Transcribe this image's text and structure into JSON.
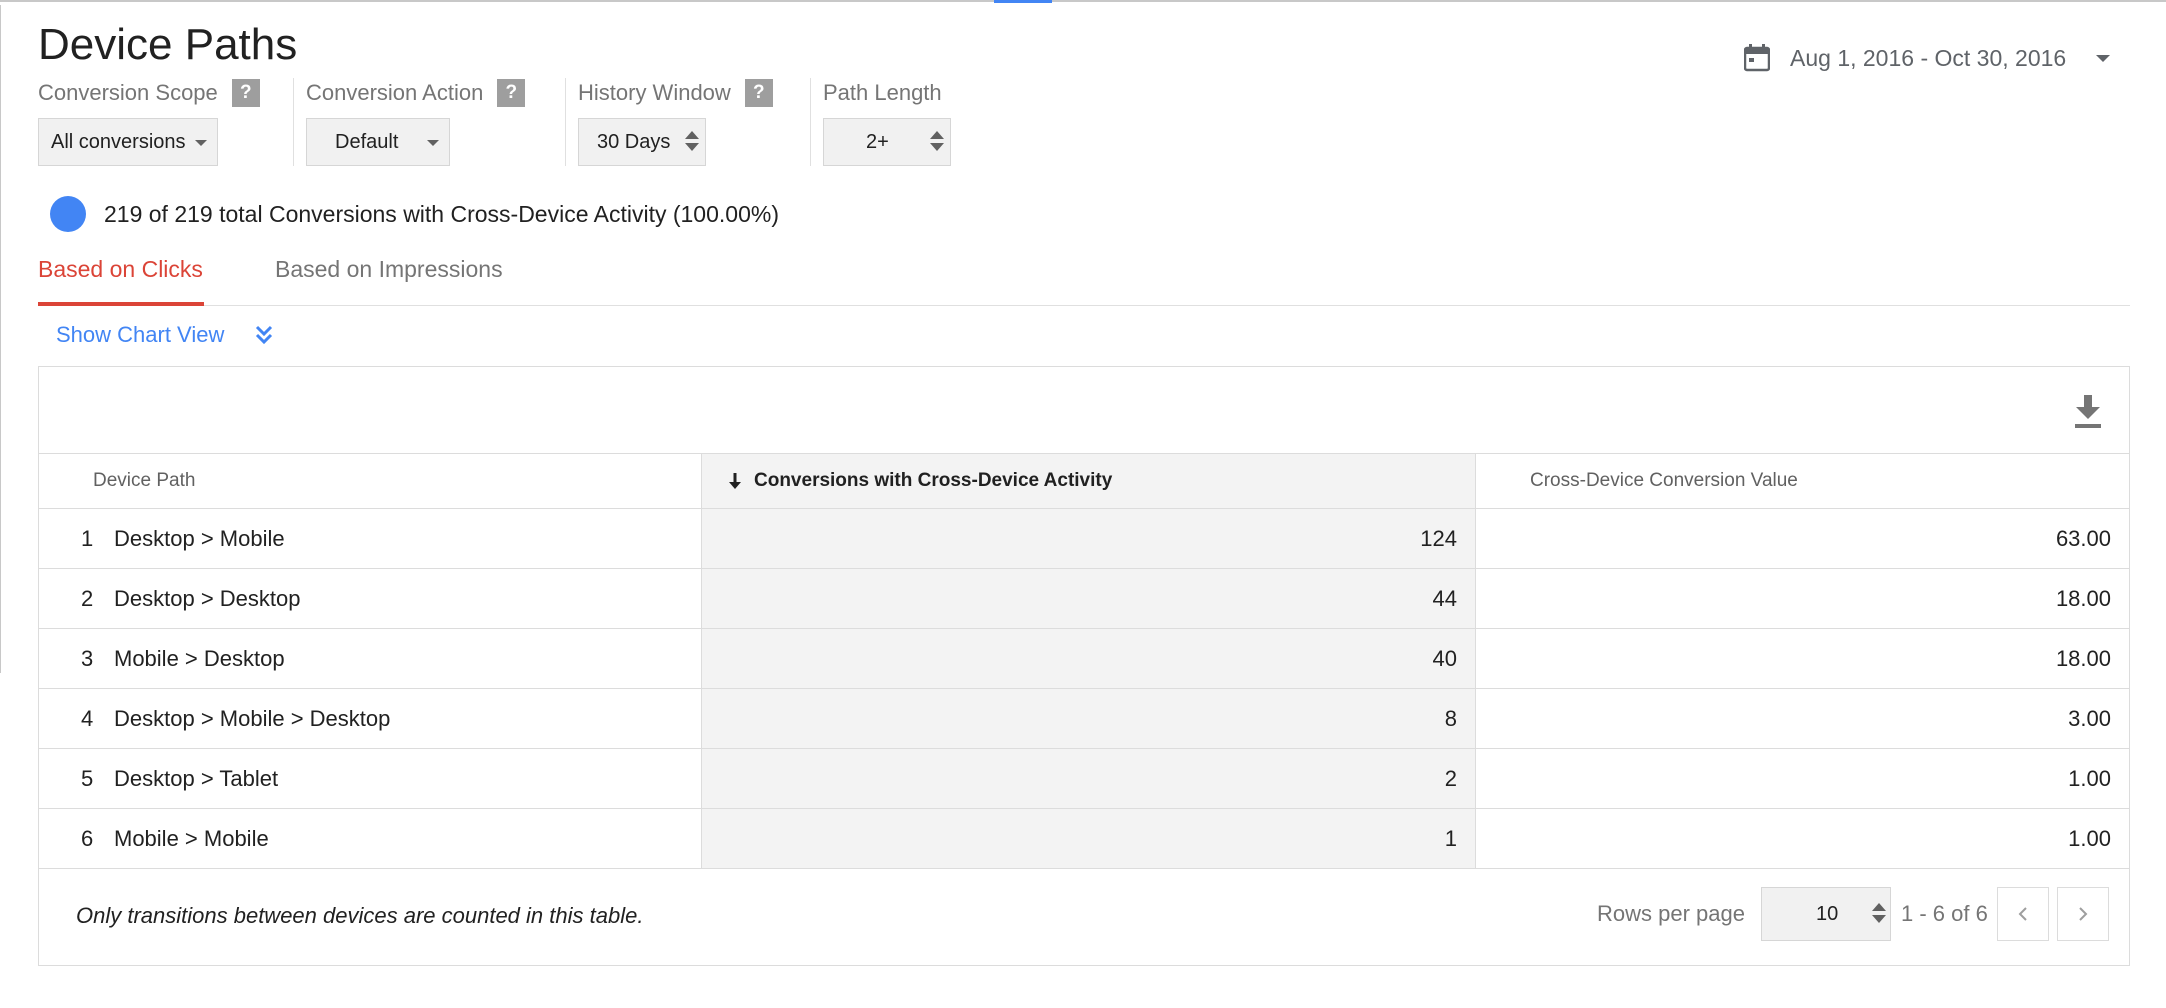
{
  "page": {
    "title": "Device Paths",
    "date_range": "Aug 1, 2016 - Oct 30, 2016"
  },
  "filters": [
    {
      "label": "Conversion Scope",
      "value": "All conversions",
      "has_help": true,
      "control": "dropdown"
    },
    {
      "label": "Conversion Action",
      "value": "Default",
      "has_help": true,
      "control": "dropdown"
    },
    {
      "label": "History Window",
      "value": "30 Days",
      "has_help": true,
      "control": "spinner"
    },
    {
      "label": "Path Length",
      "value": "2+",
      "has_help": false,
      "control": "spinner"
    }
  ],
  "help_glyph": "?",
  "summary": {
    "text": "219 of 219 total Conversions with Cross-Device Activity (100.00%)",
    "dot_color": "#4285f4"
  },
  "tabs": [
    {
      "label": "Based on Clicks",
      "active": true
    },
    {
      "label": "Based on Impressions",
      "active": false
    }
  ],
  "chart_toggle": {
    "label": "Show Chart View"
  },
  "table": {
    "columns": [
      "Device Path",
      "Conversions with Cross-Device Activity",
      "Cross-Device Conversion Value"
    ],
    "sorted_column": "Conversions with Cross-Device Activity",
    "rows": [
      {
        "index": "1",
        "path": "Desktop > Mobile",
        "conversions": "124",
        "value": "63.00"
      },
      {
        "index": "2",
        "path": "Desktop > Desktop",
        "conversions": "44",
        "value": "18.00"
      },
      {
        "index": "3",
        "path": "Mobile > Desktop",
        "conversions": "40",
        "value": "18.00"
      },
      {
        "index": "4",
        "path": "Desktop > Mobile > Desktop",
        "conversions": "8",
        "value": "3.00"
      },
      {
        "index": "5",
        "path": "Desktop > Tablet",
        "conversions": "2",
        "value": "1.00"
      },
      {
        "index": "6",
        "path": "Mobile > Mobile",
        "conversions": "1",
        "value": "1.00"
      }
    ],
    "footer_note": "Only transitions between devices are counted in this table.",
    "rows_per_page_label": "Rows per page",
    "rows_per_page_value": "10",
    "range_text": "1 - 6 of 6"
  },
  "colors": {
    "accent": "#4285f4",
    "active_tab": "#db4437"
  },
  "icons": [
    "calendar-icon",
    "dropdown-caret-icon",
    "spinner-arrows-icon",
    "help-icon",
    "double-chevron-down-icon",
    "download-icon",
    "sort-arrow-down-icon",
    "chevron-left-icon",
    "chevron-right-icon"
  ]
}
